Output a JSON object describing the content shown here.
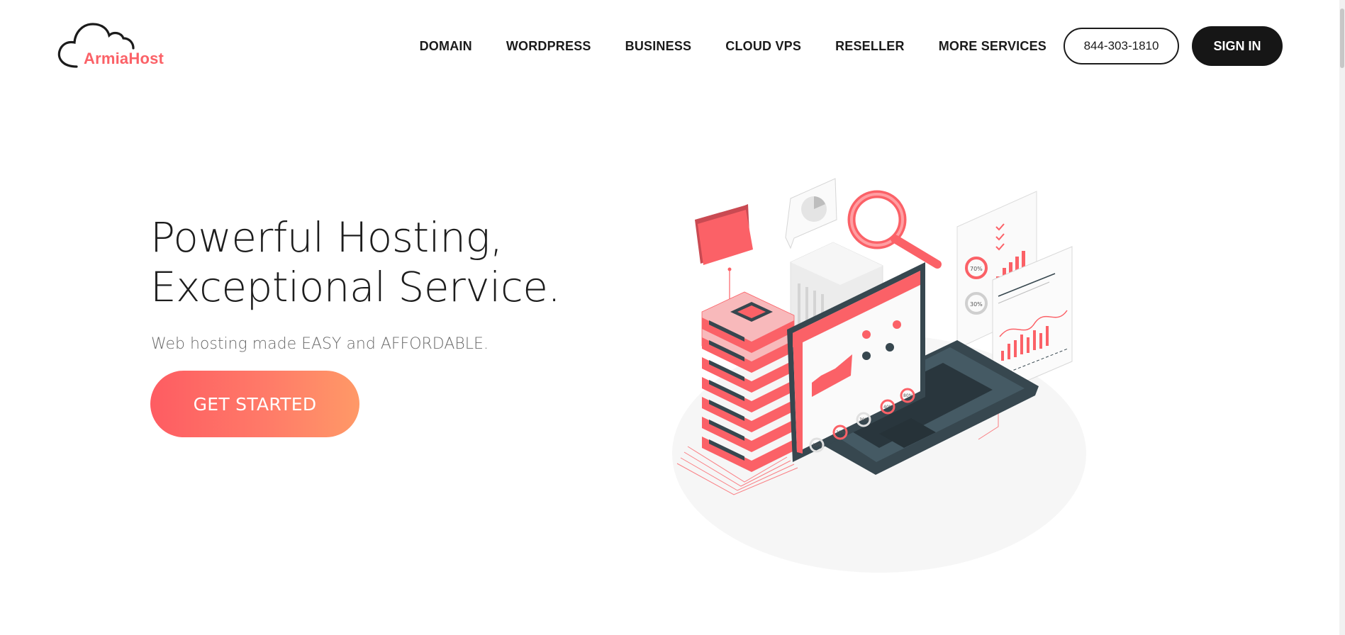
{
  "brand": {
    "name": "ArmiaHost",
    "accent_color": "#fb6167",
    "logo_icon": "cloud-icon"
  },
  "nav": {
    "items": [
      {
        "label": "DOMAIN"
      },
      {
        "label": "WORDPRESS"
      },
      {
        "label": "BUSINESS"
      },
      {
        "label": "CLOUD VPS"
      },
      {
        "label": "RESELLER"
      },
      {
        "label": "MORE SERVICES"
      }
    ],
    "phone": "844-303-1810",
    "signin_label": "SIGN IN"
  },
  "hero": {
    "title_line1": "Powerful Hosting,",
    "title_line2": "Exceptional Service.",
    "subtitle": "Web hosting made EASY and AFFORDABLE.",
    "cta_label": "GET STARTED",
    "cta_gradient": [
      "#fe5c62",
      "#ff9967"
    ]
  },
  "illustration": {
    "label_70": "70%",
    "label_30": "30%",
    "dial_labels": [
      "10%",
      "20%",
      "30%",
      "40%",
      "80%"
    ],
    "colors": {
      "accent": "#fb6167",
      "dark": "#37474f",
      "light": "#ebebeb"
    }
  }
}
